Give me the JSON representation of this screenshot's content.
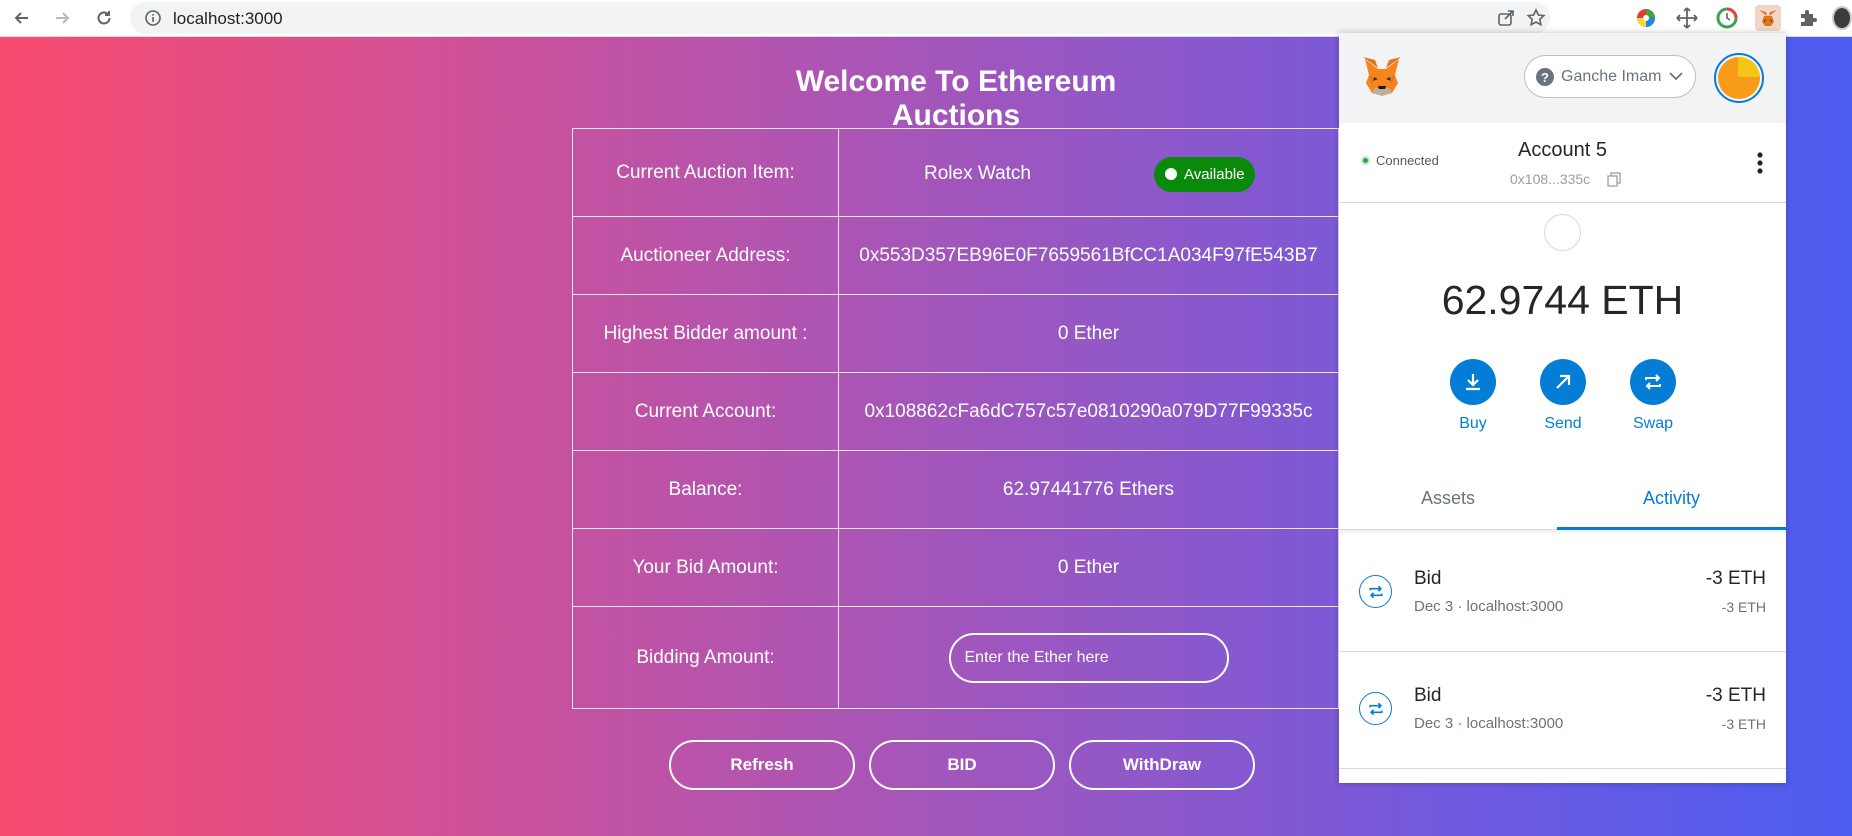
{
  "browser": {
    "url": "localhost:3000"
  },
  "page": {
    "title": "Welcome To Ethereum Auctions",
    "rows": {
      "item": {
        "label": "Current Auction Item:",
        "value": "Rolex Watch",
        "status": "Available"
      },
      "auctioneer": {
        "label": "Auctioneer Address:",
        "value": "0x553D357EB96E0F7659561BfCC1A034F97fE543B7"
      },
      "highest": {
        "label": "Highest Bidder amount :",
        "value": "0 Ether"
      },
      "current": {
        "label": "Current Account:",
        "value": "0x108862cFa6dC757c57e0810290a079D77F99335c"
      },
      "balance": {
        "label": "Balance:",
        "value": "62.97441776 Ethers"
      },
      "your_bid": {
        "label": "Your Bid Amount:",
        "value": "0 Ether"
      },
      "bidding": {
        "label": "Bidding Amount:",
        "placeholder": "Enter the Ether here"
      }
    },
    "buttons": {
      "refresh": "Refresh",
      "bid": "BID",
      "withdraw": "WithDraw"
    },
    "colors": {
      "gradient_start": "#f94b6f",
      "gradient_end": "#4c5cf0",
      "status_badge": "#0a8a0a"
    }
  },
  "metamask": {
    "network": "Ganche Imam",
    "connected": "Connected",
    "account_name": "Account 5",
    "account_address": "0x108...335c",
    "balance": "62.9744 ETH",
    "actions": {
      "buy": "Buy",
      "send": "Send",
      "swap": "Swap"
    },
    "tabs": {
      "assets": "Assets",
      "activity": "Activity"
    },
    "transactions": [
      {
        "title": "Bid",
        "subtitle": "Dec 3 · localhost:3000",
        "amount": "-3 ETH",
        "amount_secondary": "-3 ETH"
      },
      {
        "title": "Bid",
        "subtitle": "Dec 3 · localhost:3000",
        "amount": "-3 ETH",
        "amount_secondary": "-3 ETH"
      }
    ],
    "accent_color": "#037dd6"
  }
}
